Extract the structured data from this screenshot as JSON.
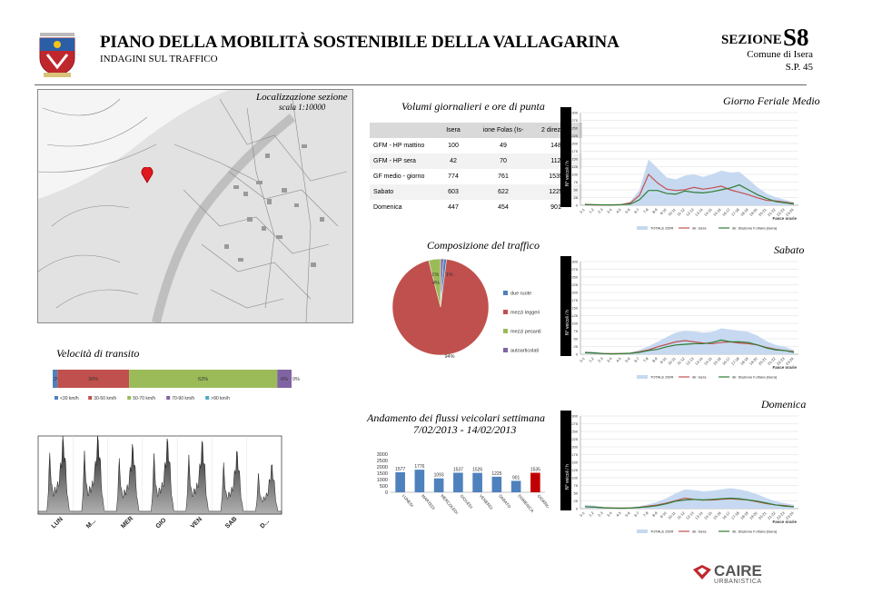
{
  "header": {
    "title": "PIANO DELLA MOBILITÀ SOSTENIBILE DELLA VALLAGARINA",
    "subtitle": "INDAGINI SUL TRAFFICO",
    "section_word": "SEZIONE",
    "section_code": "S8",
    "comune": "Comune di Isera",
    "road": "S.P. 45"
  },
  "map": {
    "title": "Localizzazione sezione",
    "scale": "scala 1:10000"
  },
  "volumes": {
    "title": "Volumi giornalieri e ore di punta",
    "headers": [
      "",
      "Isera",
      "ione Folas (Is-",
      "2 direzioni"
    ],
    "rows": [
      [
        "GFM - HP mattino",
        "100",
        "49",
        "148"
      ],
      [
        "GFM - HP sera",
        "42",
        "70",
        "112"
      ],
      [
        "GF medio - giorno",
        "774",
        "761",
        "1535"
      ],
      [
        "Sabato",
        "603",
        "622",
        "1225"
      ],
      [
        "Domenica",
        "447",
        "454",
        "901"
      ]
    ]
  },
  "hourly_titles": {
    "feriale": "Giorno Feriale Medio",
    "sabato": "Sabato",
    "domenica": "Domenica"
  },
  "composition": {
    "title": "Composizione del traffico",
    "slices": [
      {
        "label": "due ruote",
        "pct": 1,
        "text": "1%",
        "color": "#4f81bd"
      },
      {
        "label": "mezzi leggeri",
        "pct": 94,
        "text": "94%",
        "color": "#c0504d"
      },
      {
        "label": "mezzi pesanti",
        "pct": 4,
        "text": "4%",
        "color": "#9bbb59"
      },
      {
        "label": "autoarticolati",
        "pct": 1,
        "text": "1%",
        "color": "#8064a2"
      }
    ]
  },
  "speed": {
    "title": "Velocità di transito",
    "segments": [
      {
        "label": "<30 km/h",
        "pct": 2,
        "text": "2%",
        "color": "#4f81bd"
      },
      {
        "label": "30-50 km/h",
        "pct": 30,
        "text": "30%",
        "color": "#c0504d"
      },
      {
        "label": "50-70 km/h",
        "pct": 62,
        "text": "62%",
        "color": "#9bbb59"
      },
      {
        "label": "70-90 km/h",
        "pct": 6,
        "text": "6%",
        "color": "#8064a2"
      },
      {
        "label": ">90 km/h",
        "pct": 0,
        "text": "0%",
        "color": "#4bacc6"
      }
    ]
  },
  "weekly": {
    "title_line1": "Andamento dei flussi veicolari settimana",
    "title_line2": "7/02/2013 - 14/02/2013",
    "profile_days": [
      "LUN",
      "M...",
      "MER",
      "GIO",
      "VEN",
      "SAB",
      "D..."
    ]
  },
  "chart_data": [
    {
      "type": "pie",
      "title": "Composizione del traffico",
      "categories": [
        "due ruote",
        "mezzi leggeri",
        "mezzi pesanti",
        "autoarticolati"
      ],
      "values": [
        1,
        94,
        4,
        1
      ]
    },
    {
      "type": "bar",
      "stacked": true,
      "title": "Velocità di transito",
      "categories": [
        "<30 km/h",
        "30-50 km/h",
        "50-70 km/h",
        "70-90 km/h",
        ">90 km/h"
      ],
      "values": [
        2,
        30,
        62,
        6,
        0
      ]
    },
    {
      "type": "bar",
      "categories": [
        "LUNEDI",
        "MARTEDI",
        "MERCOLEDI",
        "GIOVEDI",
        "VENERDI",
        "SABATO",
        "DOMENICA",
        "GIORNO FERIALE MEDIO"
      ],
      "values": [
        1577,
        1776,
        1093,
        1537,
        1526,
        1225,
        901,
        1535
      ],
      "ylim": [
        0,
        3000
      ],
      "yticks": [
        0,
        500,
        1000,
        1500,
        2000,
        2500,
        3000
      ]
    },
    {
      "type": "line",
      "title": "Giorno Feriale Medio",
      "ylabel": "N° veicoli / h",
      "xlabel": "Fasce orarie",
      "ylim": [
        0,
        300
      ],
      "x": [
        "0-1",
        "1-2",
        "2-3",
        "3-4",
        "4-5",
        "5-6",
        "6-7",
        "7-8",
        "8-9",
        "9-10",
        "10-11",
        "11-12",
        "12-13",
        "13-14",
        "14-15",
        "15-16",
        "16-17",
        "17-18",
        "18-19",
        "19-20",
        "20-21",
        "21-22",
        "22-23",
        "23-24"
      ],
      "series": [
        {
          "name": "TOTALE 2DIR",
          "values": [
            5,
            3,
            2,
            2,
            4,
            12,
            50,
            148,
            120,
            90,
            84,
            96,
            100,
            92,
            100,
            112,
            106,
            108,
            84,
            58,
            38,
            26,
            18,
            10
          ]
        },
        {
          "name": "dir. Isera",
          "values": [
            3,
            1,
            1,
            1,
            2,
            8,
            32,
            100,
            72,
            52,
            48,
            50,
            58,
            52,
            56,
            62,
            50,
            42,
            34,
            24,
            16,
            14,
            10,
            6
          ]
        },
        {
          "name": "dir. Stazione F.ottara (Isera)",
          "values": [
            2,
            2,
            1,
            1,
            2,
            4,
            18,
            48,
            48,
            38,
            36,
            46,
            42,
            40,
            44,
            50,
            56,
            66,
            50,
            34,
            22,
            12,
            8,
            4
          ]
        }
      ]
    },
    {
      "type": "line",
      "title": "Sabato",
      "ylabel": "N° veicoli / h",
      "xlabel": "Fasce orarie",
      "ylim": [
        0,
        300
      ],
      "x": [
        "0-1",
        "1-2",
        "2-3",
        "3-4",
        "4-5",
        "5-6",
        "6-7",
        "7-8",
        "8-9",
        "9-10",
        "10-11",
        "11-12",
        "12-13",
        "13-14",
        "14-15",
        "15-16",
        "16-17",
        "17-18",
        "18-19",
        "19-20",
        "20-21",
        "21-22",
        "22-23",
        "23-24"
      ],
      "series": [
        {
          "name": "TOTALE 2DIR",
          "values": [
            10,
            8,
            4,
            3,
            4,
            6,
            14,
            26,
            40,
            56,
            70,
            76,
            74,
            70,
            72,
            84,
            80,
            76,
            72,
            60,
            42,
            30,
            24,
            14
          ]
        },
        {
          "name": "dir. Isera",
          "values": [
            5,
            4,
            2,
            2,
            2,
            3,
            8,
            14,
            24,
            32,
            40,
            44,
            40,
            36,
            34,
            38,
            40,
            36,
            34,
            30,
            22,
            16,
            12,
            8
          ]
        },
        {
          "name": "dir. Stazione F.ottara (Isera)",
          "values": [
            5,
            4,
            2,
            1,
            2,
            3,
            6,
            12,
            16,
            24,
            30,
            32,
            34,
            34,
            38,
            46,
            40,
            40,
            38,
            30,
            20,
            14,
            12,
            6
          ]
        }
      ]
    },
    {
      "type": "line",
      "title": "Domenica",
      "ylabel": "N° veicoli / h",
      "xlabel": "Fasce orarie",
      "ylim": [
        0,
        300
      ],
      "x": [
        "0-1",
        "1-2",
        "2-3",
        "3-4",
        "4-5",
        "5-6",
        "6-7",
        "7-8",
        "8-9",
        "9-10",
        "10-11",
        "11-12",
        "12-13",
        "13-14",
        "14-15",
        "15-16",
        "16-17",
        "17-18",
        "18-19",
        "19-20",
        "20-21",
        "21-22",
        "22-23",
        "23-24"
      ],
      "series": [
        {
          "name": "TOTALE 2DIR",
          "values": [
            12,
            10,
            6,
            4,
            3,
            4,
            8,
            14,
            22,
            34,
            50,
            62,
            60,
            56,
            58,
            62,
            66,
            62,
            56,
            46,
            34,
            24,
            18,
            12
          ]
        },
        {
          "name": "dir. Isera",
          "values": [
            6,
            5,
            3,
            2,
            2,
            2,
            4,
            8,
            12,
            18,
            26,
            34,
            30,
            28,
            28,
            30,
            32,
            30,
            28,
            22,
            16,
            12,
            10,
            6
          ]
        },
        {
          "name": "dir. Stazione F.ottara (Isera)",
          "values": [
            6,
            5,
            3,
            2,
            1,
            2,
            4,
            6,
            10,
            16,
            24,
            28,
            30,
            28,
            30,
            32,
            34,
            32,
            28,
            24,
            18,
            12,
            8,
            6
          ]
        }
      ]
    }
  ],
  "footer": {
    "brand": "CAIRE",
    "brand_sub": "URBANISTICA"
  }
}
